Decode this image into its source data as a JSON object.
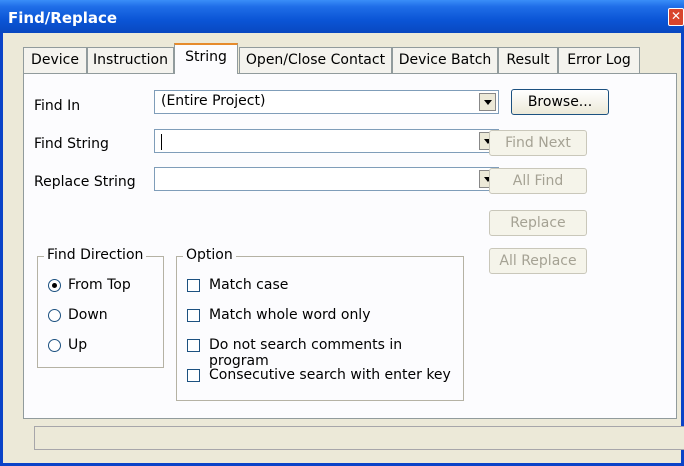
{
  "window": {
    "title": "Find/Replace"
  },
  "tabs": [
    {
      "label": "Device"
    },
    {
      "label": "Instruction"
    },
    {
      "label": "String"
    },
    {
      "label": "Open/Close Contact"
    },
    {
      "label": "Device Batch"
    },
    {
      "label": "Result"
    },
    {
      "label": "Error Log"
    }
  ],
  "active_tab": "String",
  "form": {
    "find_in_label": "Find In",
    "find_in_value": "(Entire Project)",
    "find_string_label": "Find String",
    "find_string_value": "",
    "replace_string_label": "Replace String",
    "replace_string_value": ""
  },
  "buttons": {
    "browse": "Browse...",
    "find_next": "Find Next",
    "all_find": "All Find",
    "replace": "Replace",
    "all_replace": "All Replace"
  },
  "find_direction": {
    "title": "Find Direction",
    "options": [
      "From Top",
      "Down",
      "Up"
    ],
    "selected": "From Top"
  },
  "option": {
    "title": "Option",
    "items": [
      {
        "label": "Match case",
        "checked": false
      },
      {
        "label": "Match whole word only",
        "checked": false
      },
      {
        "label": "Do not search comments in program",
        "checked": false
      },
      {
        "label": "Consecutive search with enter key",
        "checked": false
      }
    ]
  },
  "colors": {
    "titlebar": "#0b55d6",
    "active_tab_accent": "#e68b2c",
    "disabled_text": "#a5a294"
  }
}
